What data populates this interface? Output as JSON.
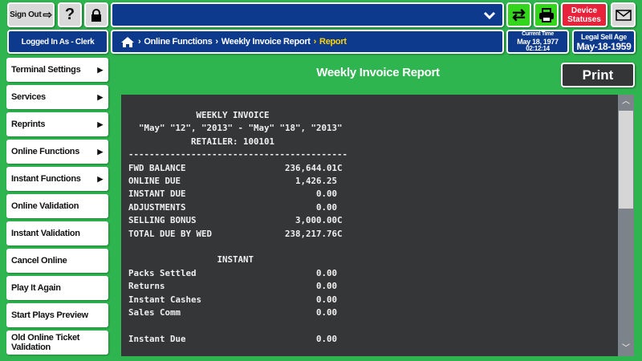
{
  "header": {
    "sign_out": "Sign Out",
    "help": "?",
    "device_statuses": "Device Statuses",
    "logged_in": "Logged In As - Clerk",
    "breadcrumb": [
      "Online Functions",
      "Weekly Invoice Report",
      "Report"
    ],
    "current_time_label": "Current Time",
    "current_date": "May 18, 1977",
    "current_time": "02:12:14",
    "legal_age_label": "Legal Sell Age",
    "legal_age_date": "May-18-1959"
  },
  "sidebar": {
    "items": [
      {
        "label": "Terminal Settings",
        "chevron": true
      },
      {
        "label": "Services",
        "chevron": true
      },
      {
        "label": "Reprints",
        "chevron": true
      },
      {
        "label": "Online Functions",
        "chevron": true
      },
      {
        "label": "Instant Functions",
        "chevron": true
      },
      {
        "label": "Online Validation",
        "chevron": false
      },
      {
        "label": "Instant Validation",
        "chevron": false
      },
      {
        "label": "Cancel Online",
        "chevron": false
      },
      {
        "label": "Play It Again",
        "chevron": false
      },
      {
        "label": "Start Plays Preview",
        "chevron": false
      },
      {
        "label": "Old Online Ticket Validation",
        "chevron": false
      }
    ]
  },
  "main": {
    "title": "Weekly Invoice Report",
    "print": "Print"
  },
  "report": {
    "title": "WEEKLY INVOICE",
    "period": "\"May\" \"12\", \"2013\" - \"May\" \"18\", \"2013\"",
    "retailer": "RETAILER: 100101",
    "summary": [
      {
        "label": "FWD BALANCE",
        "value": "236,644.01C"
      },
      {
        "label": "ONLINE DUE",
        "value": "1,426.25"
      },
      {
        "label": "INSTANT DUE",
        "value": "0.00"
      },
      {
        "label": "ADJUSTMENTS",
        "value": "0.00"
      },
      {
        "label": "SELLING BONUS",
        "value": "3,000.00C"
      },
      {
        "label": "TOTAL DUE BY WED",
        "value": "238,217.76C"
      }
    ],
    "instant_heading": "INSTANT",
    "instant": [
      {
        "label": "Packs Settled",
        "value": "0.00"
      },
      {
        "label": "Returns",
        "value": "0.00"
      },
      {
        "label": "Instant Cashes",
        "value": "0.00"
      },
      {
        "label": "Sales Comm",
        "value": "0.00"
      }
    ],
    "instant_due": {
      "label": "Instant Due",
      "value": "0.00"
    }
  },
  "colors": {
    "background": "#2fb54f",
    "navy": "#0e3a8e",
    "report_bg": "#353638",
    "device_statuses": "#e8223a",
    "breadcrumb_current": "#ffd400"
  }
}
